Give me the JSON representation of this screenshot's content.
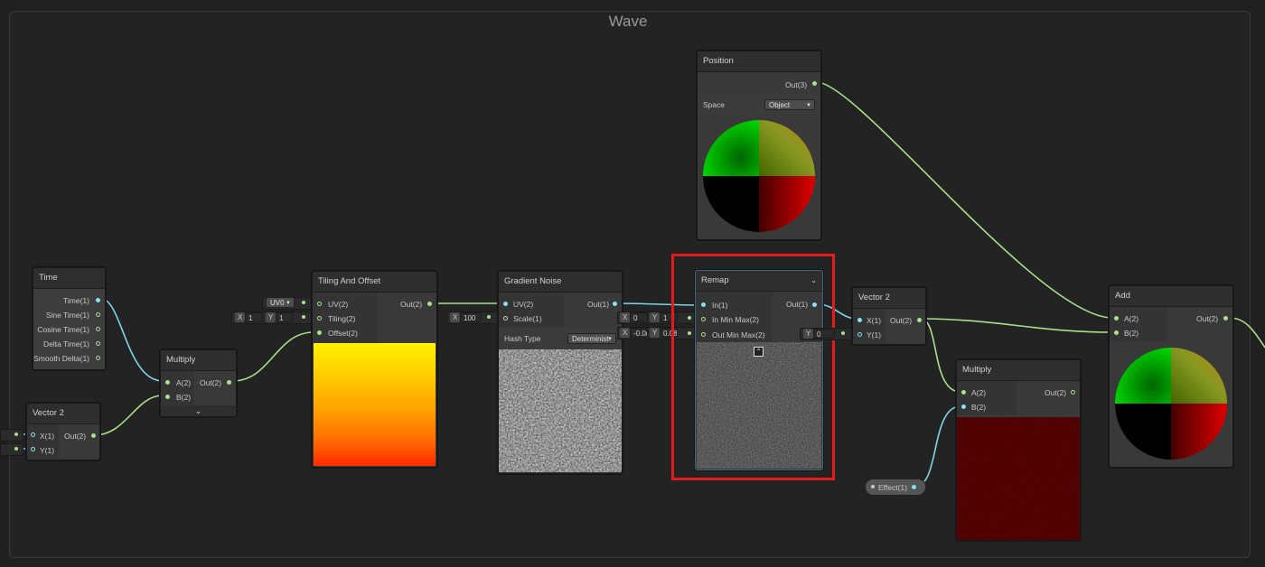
{
  "group": {
    "title": "Wave"
  },
  "colors": {
    "vector_port": "#84e3f3",
    "float_port": "#a6e38a",
    "highlight": "#e31b1b"
  },
  "nodes": {
    "time": {
      "title": "Time",
      "outputs": [
        "Time(1)",
        "Sine Time(1)",
        "Cosine Time(1)",
        "Delta Time(1)",
        "Smooth Delta(1)"
      ]
    },
    "vector2_left": {
      "title": "Vector 2",
      "inputs": [
        "X(1)",
        "Y(1)"
      ],
      "output": "Out(2)"
    },
    "multiply_left": {
      "title": "Multiply",
      "inputs": [
        "A(2)",
        "B(2)"
      ],
      "output": "Out(2)",
      "expand_icon": "chevron-down-icon"
    },
    "tiling_offset": {
      "title": "Tiling And Offset",
      "inputs": [
        "UV(2)",
        "Tiling(2)",
        "Offset(2)"
      ],
      "output": "Out(2)",
      "uv_dropdown": "UV0",
      "tiling_x_label": "X",
      "tiling_x": "1",
      "tiling_y_label": "Y",
      "tiling_y": "1"
    },
    "gradient_noise": {
      "title": "Gradient Noise",
      "inputs": [
        "UV(2)",
        "Scale(1)"
      ],
      "output": "Out(1)",
      "scale_x_label": "X",
      "scale_x": "100",
      "hash_label": "Hash Type",
      "hash_value": "Determinist"
    },
    "remap": {
      "title": "Remap",
      "inputs": [
        "In(1)",
        "In Min Max(2)",
        "Out Min Max(2)"
      ],
      "output": "Out(1)",
      "in_x_label": "X",
      "in_x": "0",
      "in_y_label": "Y",
      "in_y": "1",
      "out_x_label": "X",
      "out_x": "-0.0(",
      "out_y_label": "Y",
      "out_y": "0.08",
      "collapse_icon": "chevron-up-icon",
      "menu_icon": "chevron-down-icon"
    },
    "vector2_mid": {
      "title": "Vector 2",
      "inputs": [
        "X(1)",
        "Y(1)"
      ],
      "output": "Out(2)",
      "y_label": "Y",
      "y_value": "0"
    },
    "position": {
      "title": "Position",
      "output": "Out(3)",
      "space_label": "Space",
      "space_value": "Object"
    },
    "multiply_right": {
      "title": "Multiply",
      "inputs": [
        "A(2)",
        "B(2)"
      ],
      "output": "Out(2)"
    },
    "effect": {
      "label": "Effect(1)"
    },
    "add": {
      "title": "Add",
      "inputs": [
        "A(2)",
        "B(2)"
      ],
      "output": "Out(2)"
    }
  }
}
